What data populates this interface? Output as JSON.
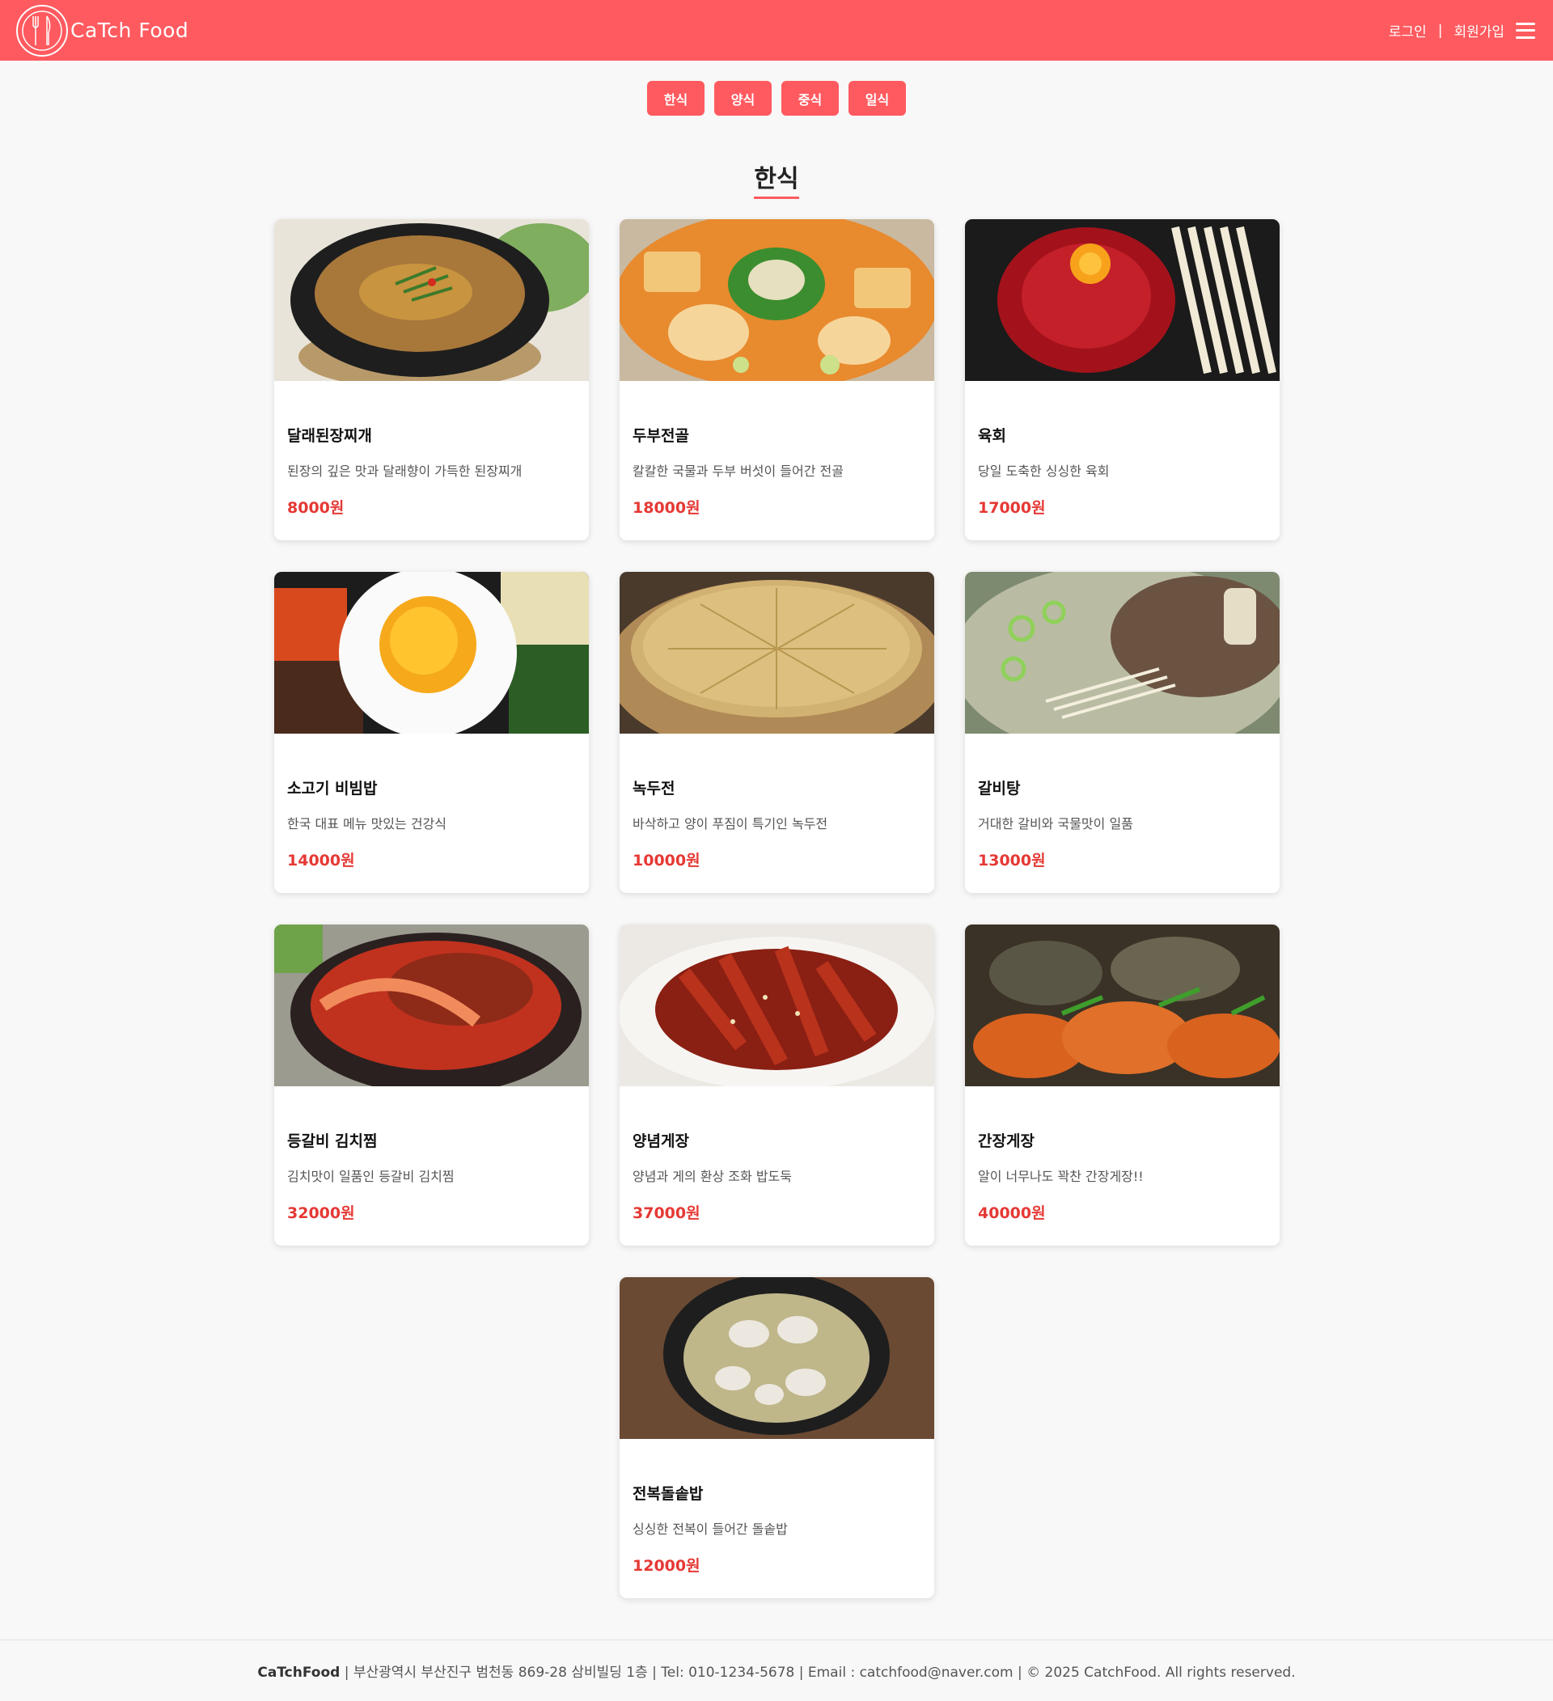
{
  "header": {
    "logo_text": "CaTch Food",
    "login": "로그인",
    "separator": "|",
    "signup": "회원가입",
    "menu_icon": "hamburger-icon"
  },
  "categories": [
    "한식",
    "양식",
    "중식",
    "일식"
  ],
  "section_title": "한식",
  "menu": [
    {
      "name": "달래된장찌개",
      "desc": "된장의 깊은 맛과 달래향이 가득한 된장찌개",
      "price": "8000원",
      "image": "doenjang-stew-photo"
    },
    {
      "name": "두부전골",
      "desc": "칼칼한 국물과 두부 버섯이 들어간 전골",
      "price": "18000원",
      "image": "tofu-hotpot-photo"
    },
    {
      "name": "육회",
      "desc": "당일 도축한 싱싱한 육회",
      "price": "17000원",
      "image": "yukhoe-photo"
    },
    {
      "name": "소고기 비빔밥",
      "desc": "한국 대표 메뉴 맛있는 건강식",
      "price": "14000원",
      "image": "bibimbap-photo"
    },
    {
      "name": "녹두전",
      "desc": "바삭하고 양이 푸짐이 특기인 녹두전",
      "price": "10000원",
      "image": "mungbean-pancake-photo"
    },
    {
      "name": "갈비탕",
      "desc": "거대한 갈비와 국물맛이 일품",
      "price": "13000원",
      "image": "galbitang-photo"
    },
    {
      "name": "등갈비 김치찜",
      "desc": "김치맛이 일품인 등갈비 김치찜",
      "price": "32000원",
      "image": "kimchi-jjim-photo"
    },
    {
      "name": "양념게장",
      "desc": "양념과 게의 환상 조화 밥도둑",
      "price": "37000원",
      "image": "yangnyeom-crab-photo"
    },
    {
      "name": "간장게장",
      "desc": "알이 너무나도 꽉찬 간장게장!!",
      "price": "40000원",
      "image": "soy-crab-photo"
    },
    {
      "name": "전복돌솥밥",
      "desc": "싱싱한 전복이 들어간 돌솥밥",
      "price": "12000원",
      "image": "abalone-rice-photo"
    }
  ],
  "footer": {
    "brand": "CaTchFood",
    "text": " | 부산광역시 부산진구 범천동 869-28 삼비빌딩 1층 | Tel: 010-1234-5678 | Email : catchfood@naver.com | © 2025 CatchFood. All rights reserved."
  },
  "colors": {
    "brand": "#ff5a5f",
    "price": "#e53935",
    "background": "#f8f8f8"
  }
}
